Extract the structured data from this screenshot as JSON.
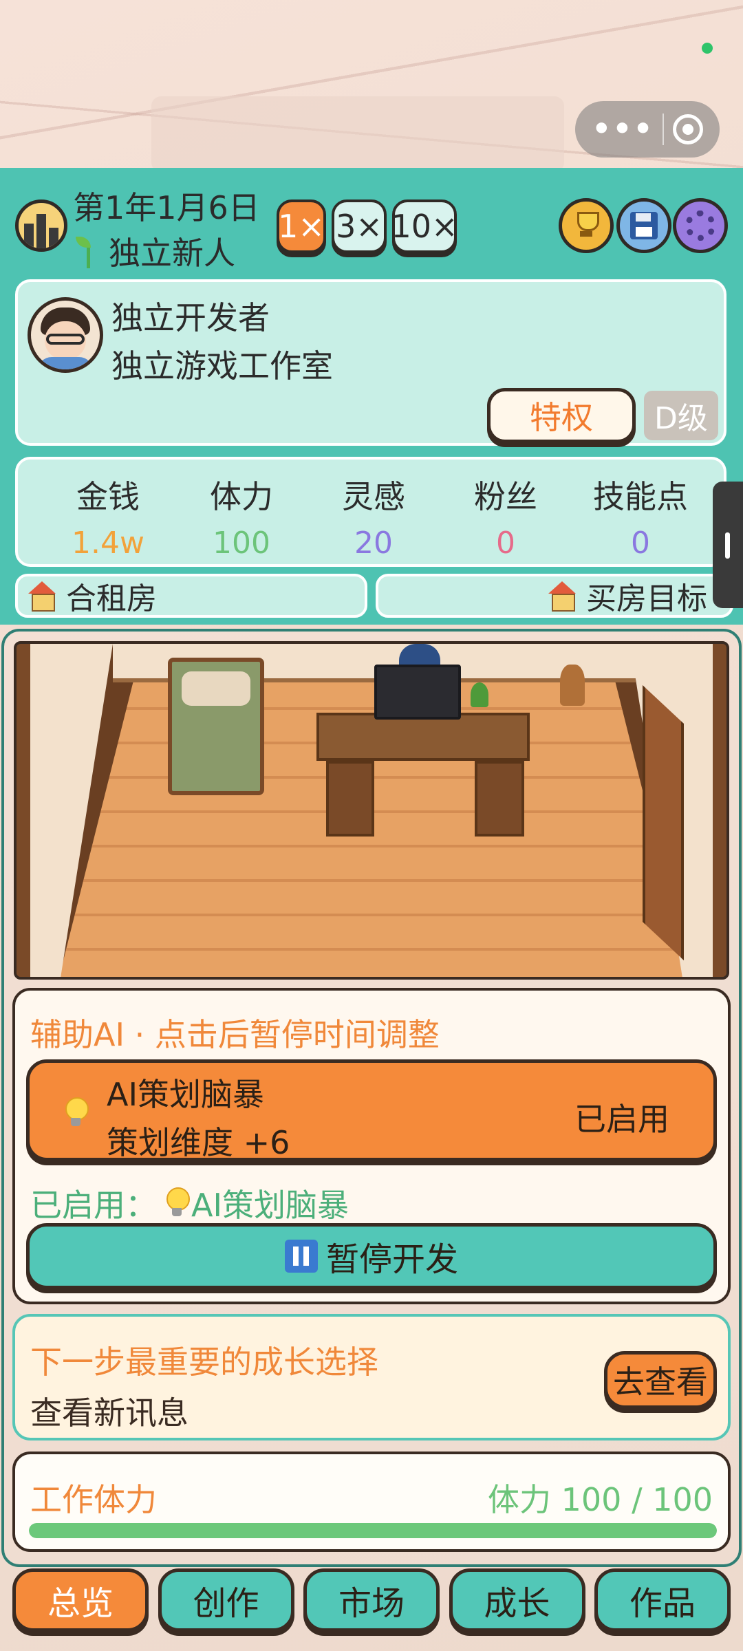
{
  "header": {
    "date": "第1年1月6日",
    "rank": "独立新人",
    "speeds": [
      "1×",
      "3×",
      "10×"
    ],
    "active_speed_index": 0
  },
  "profile": {
    "developer_name": "独立开发者",
    "studio_name": "独立游戏工作室",
    "privilege_label": "特权",
    "grade": "D级"
  },
  "stats": [
    {
      "label": "金钱",
      "value": "1.4w",
      "color": "#f2a23a"
    },
    {
      "label": "体力",
      "value": "100",
      "color": "#6cc47a"
    },
    {
      "label": "灵感",
      "value": "20",
      "color": "#8a78e0"
    },
    {
      "label": "粉丝",
      "value": "0",
      "color": "#e66b8a"
    },
    {
      "label": "技能点",
      "value": "0",
      "color": "#8a78e0"
    }
  ],
  "housing": {
    "current": "合租房",
    "goal": "买房目标"
  },
  "ai_assist": {
    "title": "辅助AI · 点击后暂停时间调整",
    "option_name": "AI策划脑暴",
    "option_effect": "策划维度 +6",
    "option_status": "已启用",
    "enabled_label": "已启用：",
    "enabled_item": "AI策划脑暴",
    "pause_label": "暂停开发"
  },
  "growth": {
    "title": "下一步最重要的成长选择",
    "subtitle": "查看新讯息",
    "button_label": "去查看"
  },
  "energy": {
    "title": "工作体力",
    "value_text": "体力 100 / 100",
    "fill_fraction": 1.0
  },
  "tabs": [
    "总览",
    "创作",
    "市场",
    "成长",
    "作品"
  ],
  "active_tab_index": 0,
  "icons": {
    "capsule_more": "more-dots-icon",
    "capsule_close": "target-close-icon",
    "trophy": "trophy-icon",
    "save": "floppy-save-icon",
    "settings": "gear-icon"
  }
}
